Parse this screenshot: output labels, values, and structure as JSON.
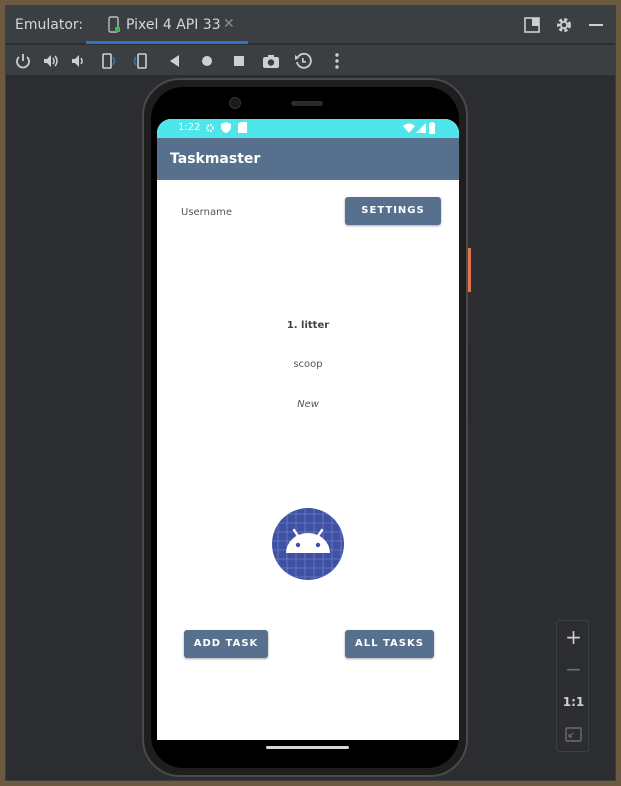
{
  "window": {
    "title": "Emulator:",
    "tab_label": "Pixel 4 API 33",
    "tab_close": "✕"
  },
  "toolbar": {
    "items": [
      "power-icon",
      "volume-up-icon",
      "volume-down-icon",
      "rotate-left-icon",
      "rotate-right-icon",
      "back-icon",
      "home-icon",
      "overview-icon",
      "screenshot-icon",
      "snapshot-icon",
      "more-icon"
    ]
  },
  "device": {
    "status_time": "1:22",
    "app_title": "Taskmaster",
    "username_label": "Username",
    "settings_button": "SETTINGS",
    "task_title": "1. litter",
    "task_body": "scoop",
    "task_state": "New",
    "add_task_button": "ADD TASK",
    "all_tasks_button": "ALL TASKS"
  },
  "zoom": {
    "plus": "+",
    "minus": "−",
    "one_to_one": "1:1"
  },
  "colors": {
    "app_bar": "#56708e",
    "status_bar": "#4ee6ea",
    "logo_bg": "#3f51a5",
    "tab_accent": "#3574c4"
  }
}
